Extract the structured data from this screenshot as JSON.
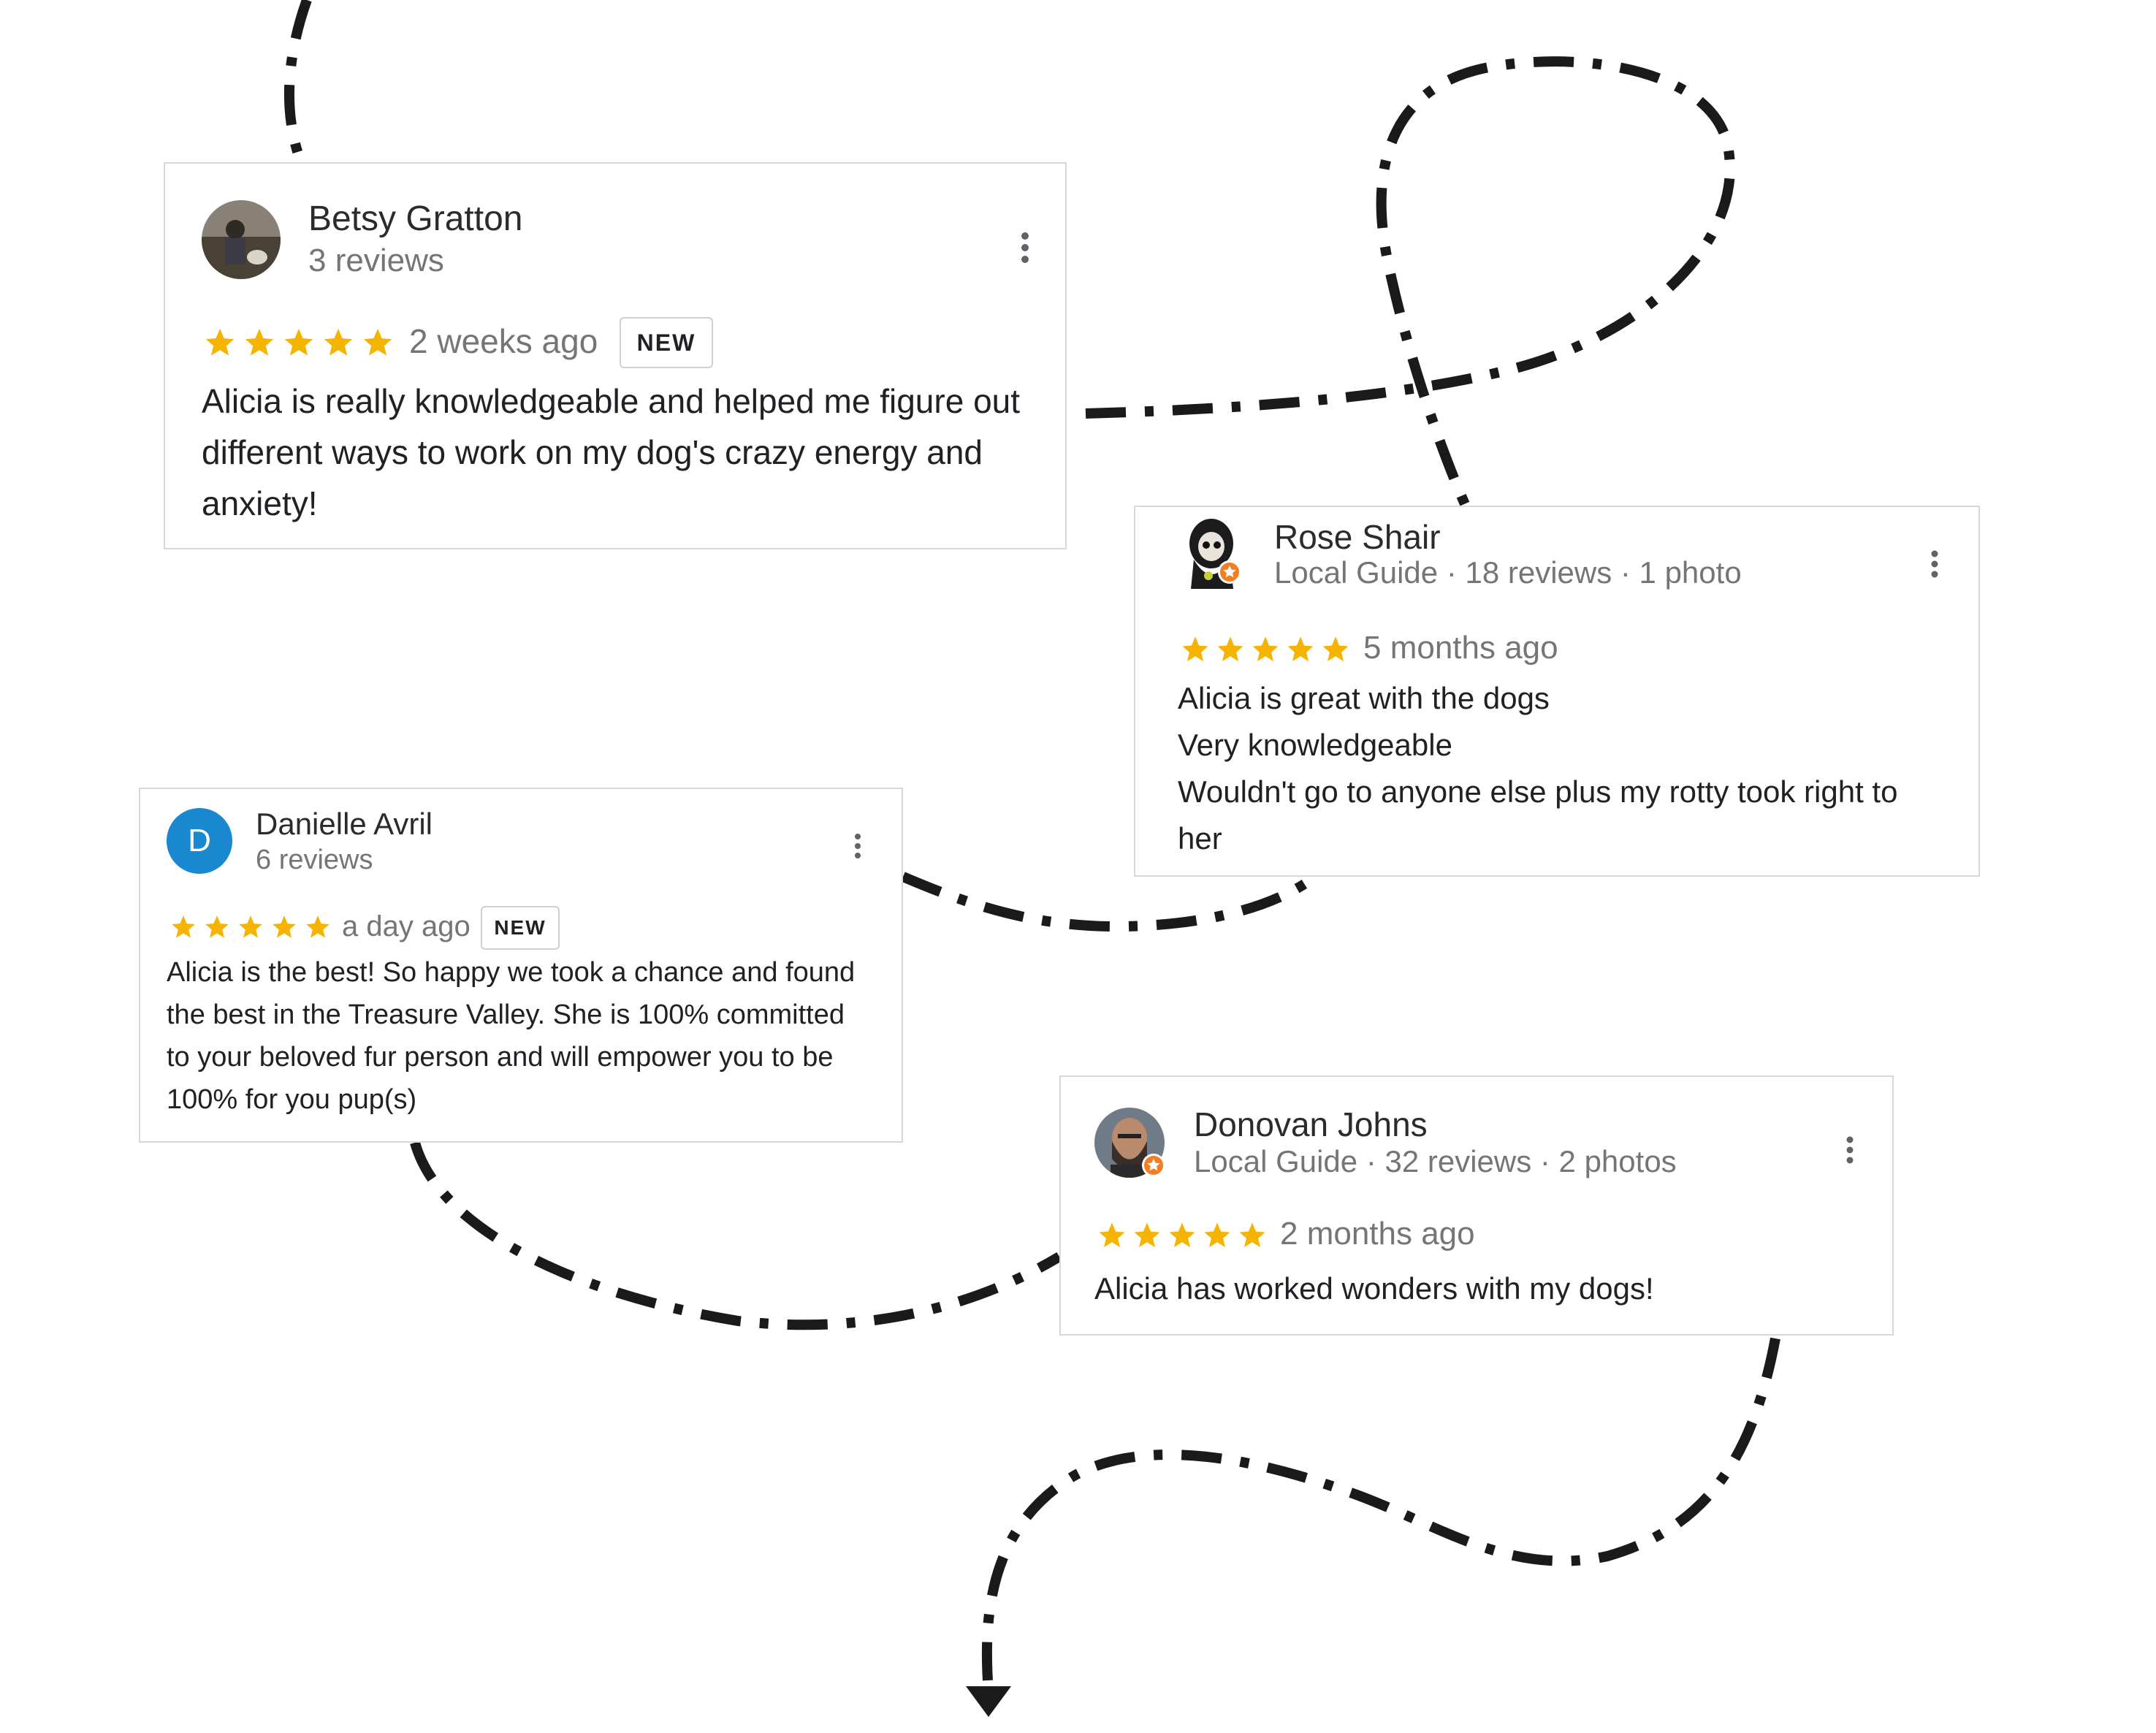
{
  "colors": {
    "star": "#f5b400",
    "path": "#1a1a1a",
    "avatar_letter_bg": "#1a87d1",
    "local_guide_badge": "#f57c1f"
  },
  "icons": {
    "menu": "vertical-dots-icon",
    "star": "star-icon",
    "local_guide": "local-guide-badge-icon",
    "arrow": "arrow-down-icon"
  },
  "reviews": [
    {
      "name": "Betsy Gratton",
      "meta": "3 reviews",
      "rating": 5,
      "time": "2 weeks ago",
      "badge": "NEW",
      "text": "Alicia is really knowledgeable and helped me figure out\ndifferent ways to work on my dog's crazy energy and\nanxiety!"
    },
    {
      "name": "Rose Shair",
      "meta": "Local Guide · 18 reviews · 1 photo",
      "rating": 5,
      "time": "5 months ago",
      "text": "Alicia is great with the dogs\nVery knowledgeable\nWouldn't go to anyone else plus my rotty took right to\nher"
    },
    {
      "name": "Danielle Avril",
      "avatar_letter": "D",
      "meta": "6 reviews",
      "rating": 5,
      "time": "a day ago",
      "badge": "NEW",
      "text": "Alicia is the best! So happy we took a chance and found\nthe best in the Treasure Valley. She is 100% committed\nto your beloved fur person and will empower you to be\n100% for you pup(s)"
    },
    {
      "name": "Donovan Johns",
      "meta": "Local Guide · 32 reviews · 2 photos",
      "rating": 5,
      "time": "2 months ago",
      "text": "Alicia has worked wonders with my dogs!"
    }
  ]
}
